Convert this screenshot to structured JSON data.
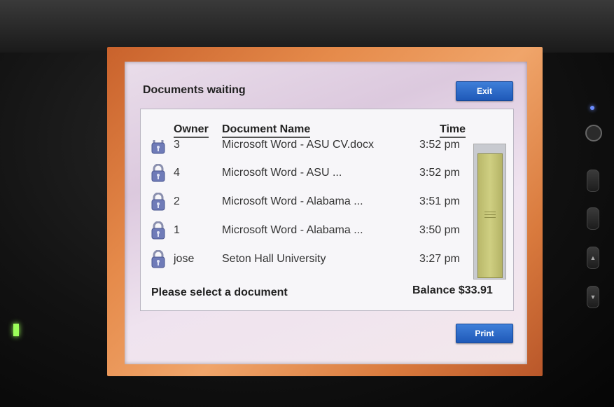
{
  "window": {
    "title": "Documents waiting"
  },
  "buttons": {
    "exit": "Exit",
    "print": "Print"
  },
  "table": {
    "headers": {
      "owner": "Owner",
      "document": "Document Name",
      "time": "Time"
    },
    "rows": [
      {
        "owner": "3",
        "document": "Microsoft Word - ASU CV.docx",
        "time": "3:52 pm"
      },
      {
        "owner": "4",
        "document": "Microsoft Word - ASU ...",
        "time": "3:52 pm"
      },
      {
        "owner": "2",
        "document": "Microsoft Word - Alabama ...",
        "time": "3:51 pm"
      },
      {
        "owner": "1",
        "document": "Microsoft Word - Alabama ...",
        "time": "3:50 pm"
      },
      {
        "owner": "jose",
        "document": "Seton Hall University",
        "time": "3:27 pm"
      }
    ]
  },
  "status": {
    "message": "Please select a document",
    "balance": "Balance $33.91"
  },
  "icons": {
    "row_icon": "padlock-icon"
  },
  "colors": {
    "button_blue": "#2a67c7",
    "scroll_thumb": "#c5c478",
    "frame_orange": "#e58a4a"
  }
}
